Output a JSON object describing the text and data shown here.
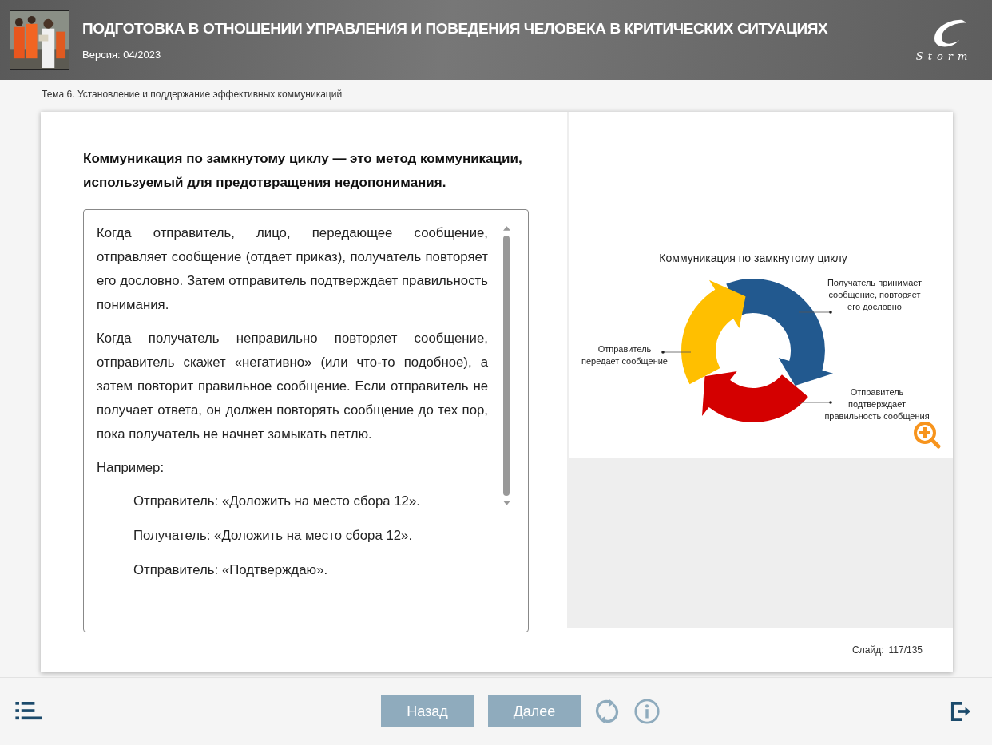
{
  "header": {
    "title": "ПОДГОТОВКА В ОТНОШЕНИИ УПРАВЛЕНИЯ И ПОВЕДЕНИЯ ЧЕЛОВЕКА В КРИТИЧЕСКИХ СИТУАЦИЯХ",
    "version": "Версия: 04/2023",
    "logo": "Storm"
  },
  "breadcrumb": "Тема 6. Установление и поддержание эффективных коммуникаций",
  "slide": {
    "heading": "Коммуникация по замкнутому циклу — это метод коммуникации, используемый для предотвращения недопонимания.",
    "paragraphs": [
      {
        "kind": "paragraph",
        "text": "Когда отправитель, лицо, передающее сообщение, отправляет сообщение (отдает приказ), получатель повторяет его дословно. Затем отправитель подтверждает правильность понимания."
      },
      {
        "kind": "paragraph",
        "text": "Когда получатель неправильно повторяет сообщение, отправитель скажет «негативно» (или что-то подобное), а затем повторит правильное сообщение. Если отправитель не получает ответа, он должен повторять сообщение до тех пор, пока получатель не начнет замыкать петлю."
      },
      {
        "kind": "paragraph",
        "text": "Например:"
      },
      {
        "kind": "example",
        "text": "Отправитель: «Доложить на место сбора 12»."
      },
      {
        "kind": "example",
        "text": "Получатель: «Доложить на место сбора 12»."
      },
      {
        "kind": "example",
        "text": "Отправитель: «Подтверждаю»."
      }
    ],
    "diagram": {
      "title": "Коммуникация по замкнутому циклу",
      "labels": [
        {
          "lines": [
            "Получатель принимает",
            "сообщение, повторяет",
            "его дословно"
          ]
        },
        {
          "lines": [
            "Отправитель",
            "передает сообщение"
          ]
        },
        {
          "lines": [
            "Отправитель",
            "подтверждает",
            "правильность сообщения"
          ]
        }
      ]
    },
    "counter_label": "Слайд:",
    "counter": "117/135"
  },
  "footer": {
    "buttons": [
      {
        "label": "Назад"
      },
      {
        "label": "Далее"
      }
    ]
  }
}
